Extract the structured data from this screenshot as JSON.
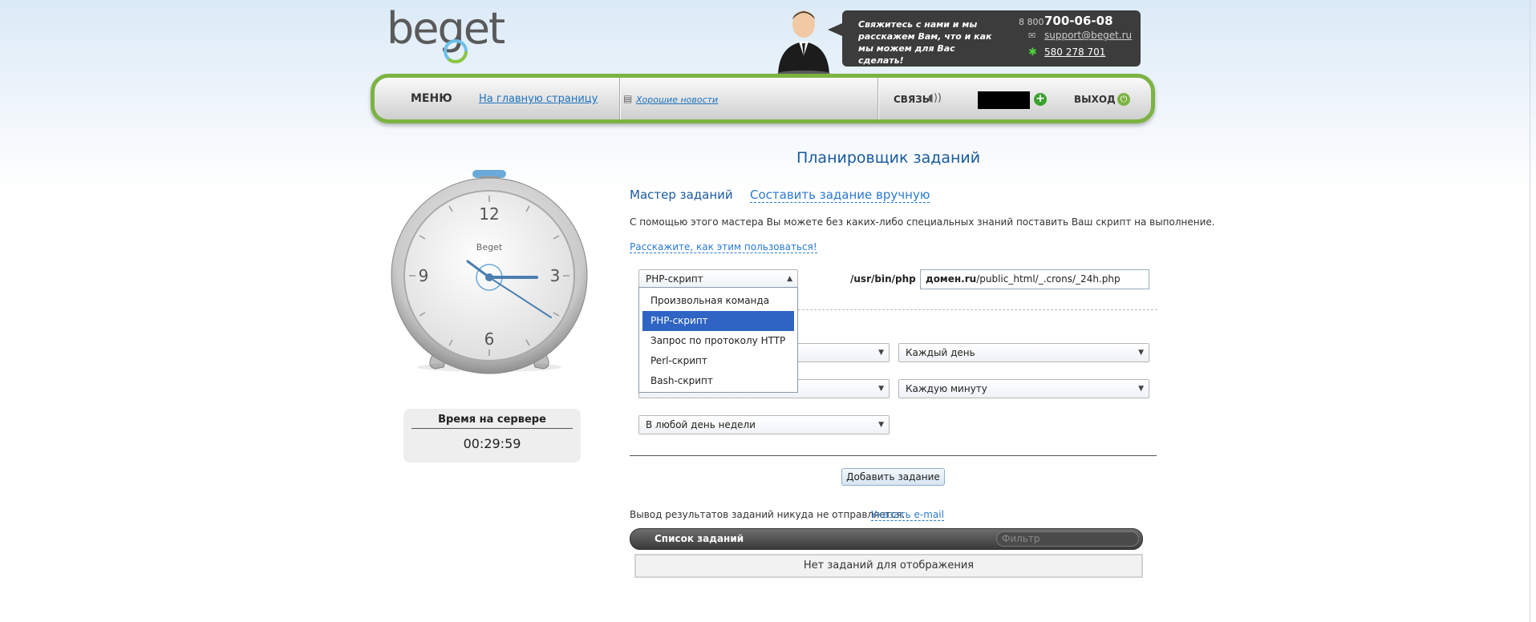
{
  "header": {
    "logo_text": "beget",
    "contact_text": "Свяжитесь с нами и мы расскажем Вам, что и как мы можем для Вас сделать!",
    "phone_prefix": "8 800",
    "phone": "700-06-08",
    "email": "support@beget.ru",
    "icq": "580 278 701"
  },
  "nav": {
    "menu": "МЕНЮ",
    "home": "На главную страницу",
    "news": "Хорошие новости",
    "contact": "СВЯЗЬ",
    "exit": "ВЫХОД"
  },
  "clock": {
    "brand": "Beget",
    "numerals": [
      "12",
      "3",
      "6",
      "9"
    ],
    "server_time_label": "Время на сервере",
    "server_time": "00:29:59"
  },
  "main": {
    "title": "Планировщик заданий",
    "tab_wizard": "Мастер заданий",
    "tab_manual": "Составить задание вручную",
    "description": "С помощью этого мастера Вы можете без каких-либо специальных знаний поставить Ваш скрипт на выполнение.",
    "howto_link": "Расскажите, как этим пользоваться!",
    "type_select_value": "PHP-скрипт",
    "command_prefix": "/usr/bin/php ~/",
    "command_domain": "домен.ru",
    "command_path": "/public_html/_.crons/_24h.php",
    "dropdown_options": [
      "Произвольная команда",
      "PHP-скрипт",
      "Запрос по протоколу HTTP",
      "Perl-скрипт",
      "Bash-скрипт"
    ],
    "dropdown_selected_index": 1,
    "schedule": {
      "row1_right": "Каждый день",
      "row2_right": "Каждую минуту",
      "row3_left": "В любой день недели"
    },
    "add_button": "Добавить задание",
    "output_text": "Вывод результатов заданий никуда не отправляется.",
    "output_link": "Указать e-mail",
    "list_title": "Список заданий",
    "filter_placeholder": "Фильтр",
    "empty_text": "Нет заданий для отображения"
  },
  "colors": {
    "accent_green": "#7cb342",
    "link_blue": "#2b7ad0",
    "title_blue": "#1a5aa0",
    "selected_blue": "#2f64c4"
  }
}
